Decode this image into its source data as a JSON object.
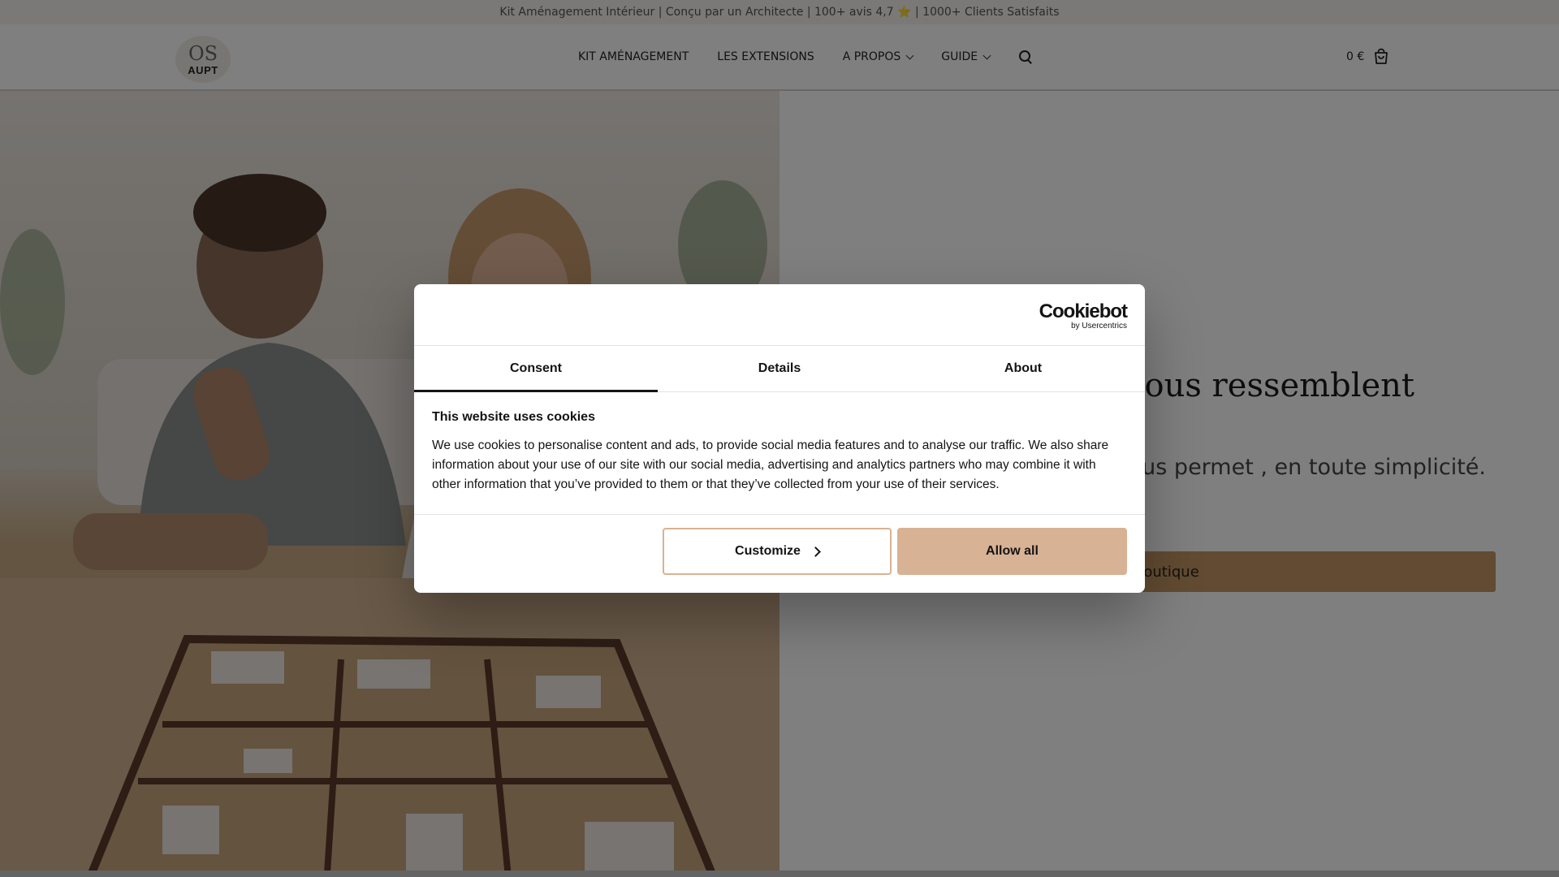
{
  "announcement": {
    "text": "Kit Aménagement Intérieur | Conçu par un Architecte | 100+ avis 4,7 ⭐ | 1000+ Clients Satisfaits"
  },
  "header": {
    "logo_top": "OS",
    "logo_bottom": "AUPT",
    "nav": [
      {
        "label": "KIT AMÉNAGEMENT",
        "has_dropdown": false
      },
      {
        "label": "LES EXTENSIONS",
        "has_dropdown": false
      },
      {
        "label": "A PROPOS",
        "has_dropdown": true
      },
      {
        "label": "GUIDE",
        "has_dropdown": true
      }
    ],
    "cart_price": "0 €"
  },
  "hero": {
    "title": "s qui vous ressemblent",
    "description": "intérieur innovant qui vous permet , en toute simplicité.",
    "cta": "la boutique",
    "cta_color": "#c59664"
  },
  "cookie_dialog": {
    "brand": "Cookiebot",
    "brand_sub": "by Usercentrics",
    "tabs": [
      "Consent",
      "Details",
      "About"
    ],
    "active_tab": "Consent",
    "heading": "This website uses cookies",
    "body": "We use cookies to personalise content and ads, to provide social media features and to analyse our traffic. We also share information about your use of our site with our social media, advertising and analytics partners who may combine it with other information that you’ve provided to them or that they’ve collected from your use of their services.",
    "customize_label": "Customize",
    "allow_label": "Allow all",
    "accent_color": "#d8b294"
  }
}
